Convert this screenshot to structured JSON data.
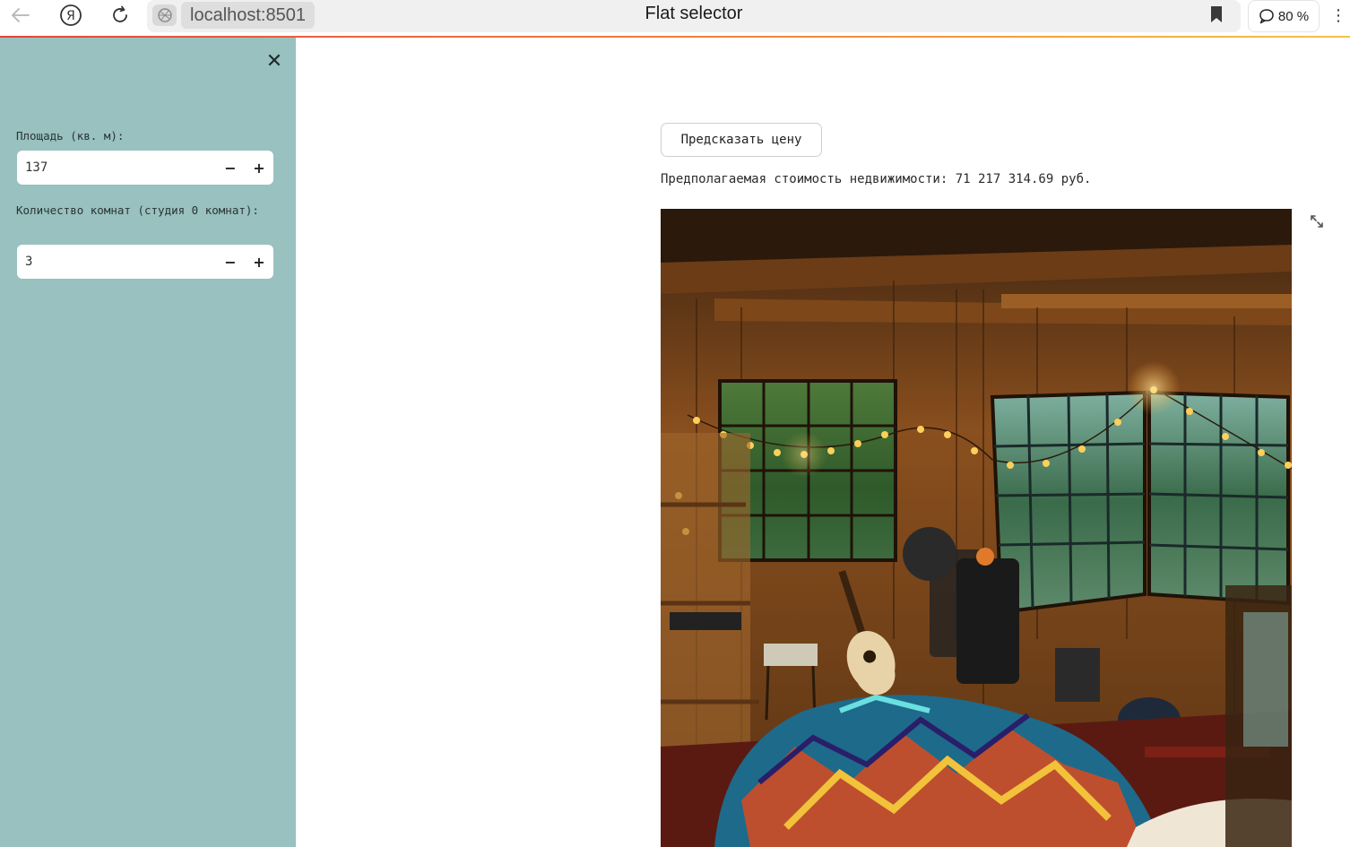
{
  "browser": {
    "url": "localhost:8501",
    "page_title": "Flat selector",
    "zoom_label": "80 %"
  },
  "sidebar": {
    "fields": [
      {
        "label": "Площадь (кв. м):",
        "value": "137",
        "minus": "−",
        "plus": "+"
      },
      {
        "label": "Количество комнат (студия 0 комнат):",
        "value": "3",
        "minus": "−",
        "plus": "+"
      }
    ],
    "close_glyph": "✕"
  },
  "main": {
    "predict_button": "Предсказать цену",
    "result": "Предполагаемая стоимость недвижимости: 71 217 314.69 руб.",
    "image_icon": "fullscreen-icon"
  },
  "colors": {
    "sidebar_bg": "#98c1c0",
    "accent_line": "#e8443a"
  }
}
